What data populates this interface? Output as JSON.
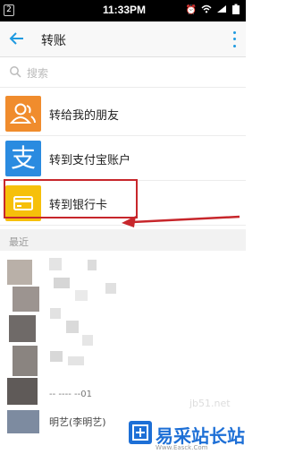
{
  "status_bar": {
    "badge": "2",
    "time": "11:33PM"
  },
  "title_bar": {
    "title": "转账"
  },
  "search": {
    "placeholder": "搜索"
  },
  "options": [
    {
      "label": "转给我的朋友",
      "icon": "friend-icon",
      "color": "#f08c2d"
    },
    {
      "label": "转到支付宝账户",
      "icon": "alipay-icon",
      "glyph": "支",
      "color": "#2a8be0"
    },
    {
      "label": "转到银行卡",
      "icon": "bank-card-icon",
      "color": "#f6c00a"
    }
  ],
  "recent": {
    "section_label": "最近",
    "visible_number": "-- ----  --01",
    "visible_name": "明艺(李明艺)"
  },
  "watermark": {
    "text": "易采站长站",
    "url": "jb51.net",
    "small": "Www.Easck.Com"
  },
  "colors": {
    "accent": "#1f9ae0",
    "highlight": "#c7262b"
  }
}
